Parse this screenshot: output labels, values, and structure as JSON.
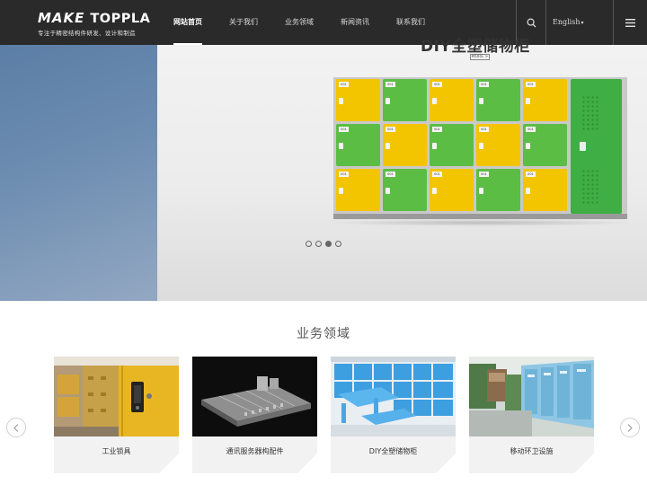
{
  "header": {
    "logo": {
      "make": "MAKE",
      "brand": "TOPPLA",
      "tagline": "专注于精密结构件研发、设计和制造"
    },
    "nav": [
      {
        "label": "网站首页",
        "active": true
      },
      {
        "label": "关于我们",
        "active": false
      },
      {
        "label": "业务领域",
        "active": false
      },
      {
        "label": "新闻资讯",
        "active": false
      },
      {
        "label": "联系我们",
        "active": false
      }
    ],
    "search_icon": "search-icon",
    "language": "English",
    "menu_icon": "hamburger-menu-icon"
  },
  "banner": {
    "title": "DIY全塑储物柜",
    "more": "MORE >",
    "locker_tag": "001",
    "slides": 4,
    "active_slide": 3
  },
  "business": {
    "title": "业务领域",
    "cards": [
      {
        "label": "工业锁具"
      },
      {
        "label": "通讯服务器构配件"
      },
      {
        "label": "DIY全塑储物柜"
      },
      {
        "label": "移动环卫设施"
      }
    ]
  },
  "colors": {
    "header_bg": "#2a2a2a",
    "locker_yellow": "#f2c500",
    "locker_green": "#5cbd45",
    "card_bg": "#f2f2f2"
  }
}
